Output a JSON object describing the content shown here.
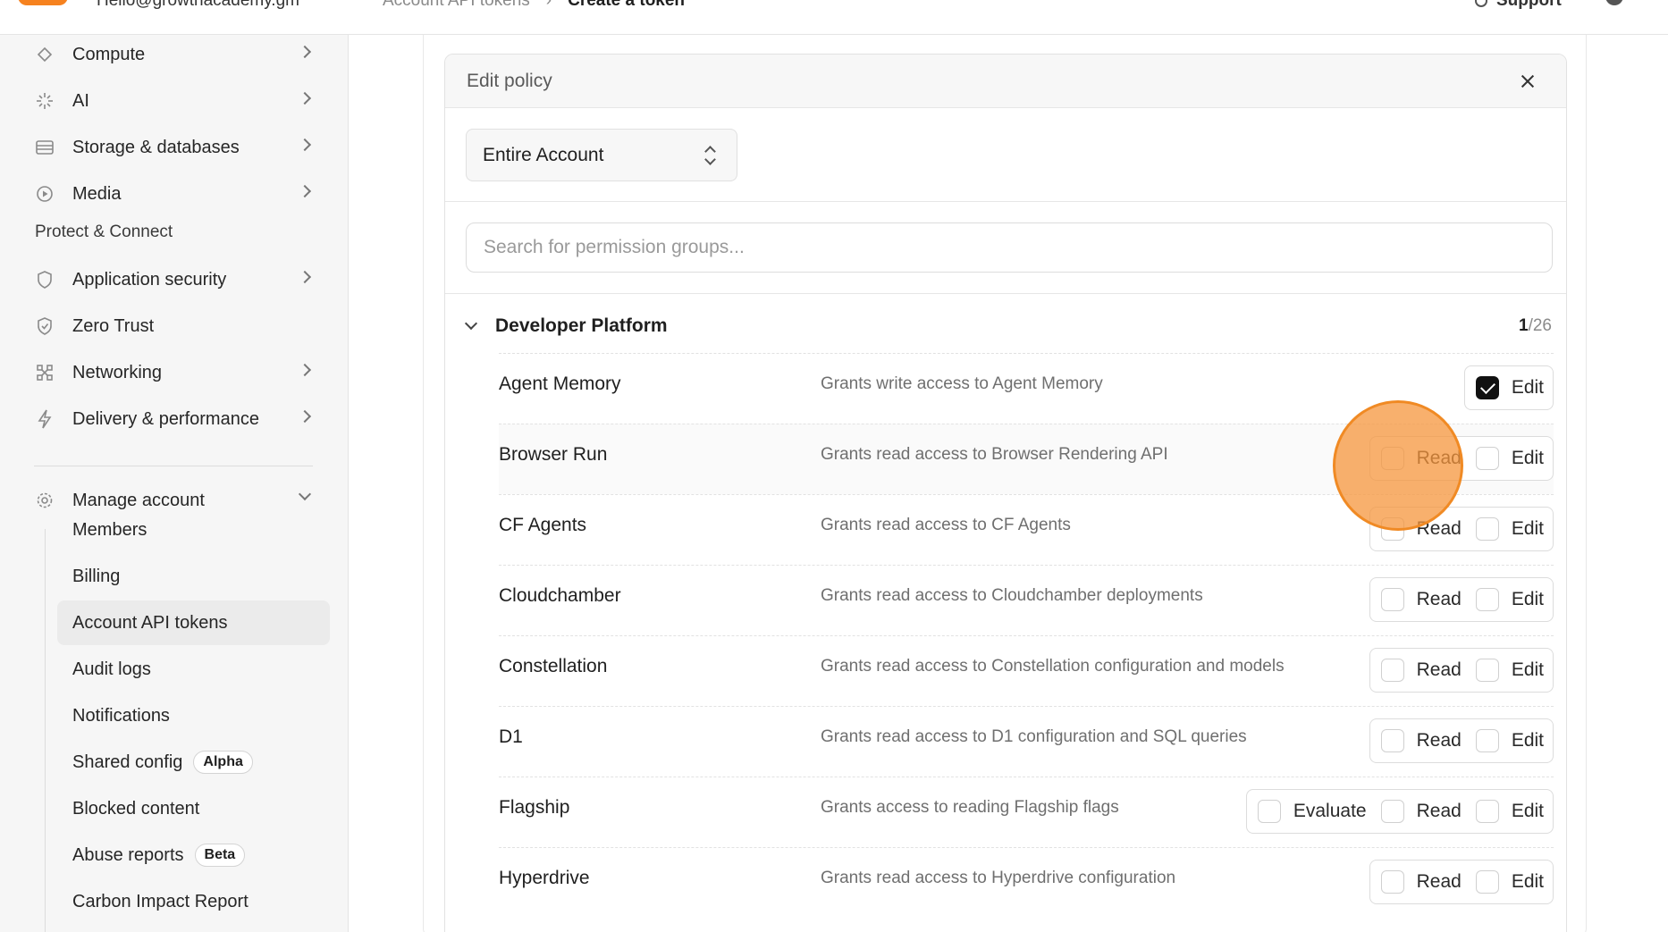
{
  "topbar": {
    "account_email": "Hello@growthacademy.gm",
    "breadcrumbs": [
      "Account API tokens",
      "›",
      "Create a token"
    ],
    "support_label": "Support"
  },
  "sidebar": {
    "items_top": [
      {
        "label": "Compute",
        "icon": "compute-icon"
      },
      {
        "label": "AI",
        "icon": "sparkle-icon"
      },
      {
        "label": "Storage & databases",
        "icon": "database-icon"
      },
      {
        "label": "Media",
        "icon": "play-icon"
      }
    ],
    "section_label": "Protect & Connect",
    "items_protect": [
      {
        "label": "Application security",
        "icon": "shield-icon"
      },
      {
        "label": "Zero Trust",
        "icon": "shield-check-icon"
      },
      {
        "label": "Networking",
        "icon": "network-icon"
      },
      {
        "label": "Delivery & performance",
        "icon": "bolt-icon"
      }
    ],
    "manage": {
      "label": "Manage account",
      "icon": "gear-icon"
    },
    "sub_items": [
      {
        "label": "Members"
      },
      {
        "label": "Billing"
      },
      {
        "label": "Account API tokens",
        "active": true
      },
      {
        "label": "Audit logs"
      },
      {
        "label": "Notifications"
      },
      {
        "label": "Shared config",
        "badge": "Alpha"
      },
      {
        "label": "Blocked content"
      },
      {
        "label": "Abuse reports",
        "badge": "Beta"
      },
      {
        "label": "Carbon Impact Report"
      }
    ]
  },
  "policy": {
    "title": "Edit policy",
    "scope_value": "Entire Account",
    "search_placeholder": "Search for permission groups...",
    "group": {
      "name": "Developer Platform",
      "selected": "1",
      "total": "/26"
    },
    "rows": [
      {
        "name": "Agent Memory",
        "desc": "Grants write access to Agent Memory",
        "options": [
          {
            "label": "Edit",
            "checked": true
          }
        ]
      },
      {
        "name": "Browser Run",
        "desc": "Grants read access to Browser Rendering API",
        "options": [
          {
            "label": "Read",
            "checked": false
          },
          {
            "label": "Edit",
            "checked": false
          }
        ]
      },
      {
        "name": "CF Agents",
        "desc": "Grants read access to CF Agents",
        "options": [
          {
            "label": "Read",
            "checked": false
          },
          {
            "label": "Edit",
            "checked": false
          }
        ]
      },
      {
        "name": "Cloudchamber",
        "desc": "Grants read access to Cloudchamber deployments",
        "options": [
          {
            "label": "Read",
            "checked": false
          },
          {
            "label": "Edit",
            "checked": false
          }
        ]
      },
      {
        "name": "Constellation",
        "desc": "Grants read access to Constellation configuration and models",
        "options": [
          {
            "label": "Read",
            "checked": false
          },
          {
            "label": "Edit",
            "checked": false
          }
        ]
      },
      {
        "name": "D1",
        "desc": "Grants read access to D1 configuration and SQL queries",
        "options": [
          {
            "label": "Read",
            "checked": false
          },
          {
            "label": "Edit",
            "checked": false
          }
        ]
      },
      {
        "name": "Flagship",
        "desc": "Grants access to reading Flagship flags",
        "options": [
          {
            "label": "Evaluate",
            "checked": false
          },
          {
            "label": "Read",
            "checked": false
          },
          {
            "label": "Edit",
            "checked": false
          }
        ]
      },
      {
        "name": "Hyperdrive",
        "desc": "Grants read access to Hyperdrive configuration",
        "options": [
          {
            "label": "Read",
            "checked": false
          },
          {
            "label": "Edit",
            "checked": false
          }
        ]
      }
    ]
  },
  "colors": {
    "accent": "#f6821f",
    "click_highlight": "#f08a24"
  }
}
